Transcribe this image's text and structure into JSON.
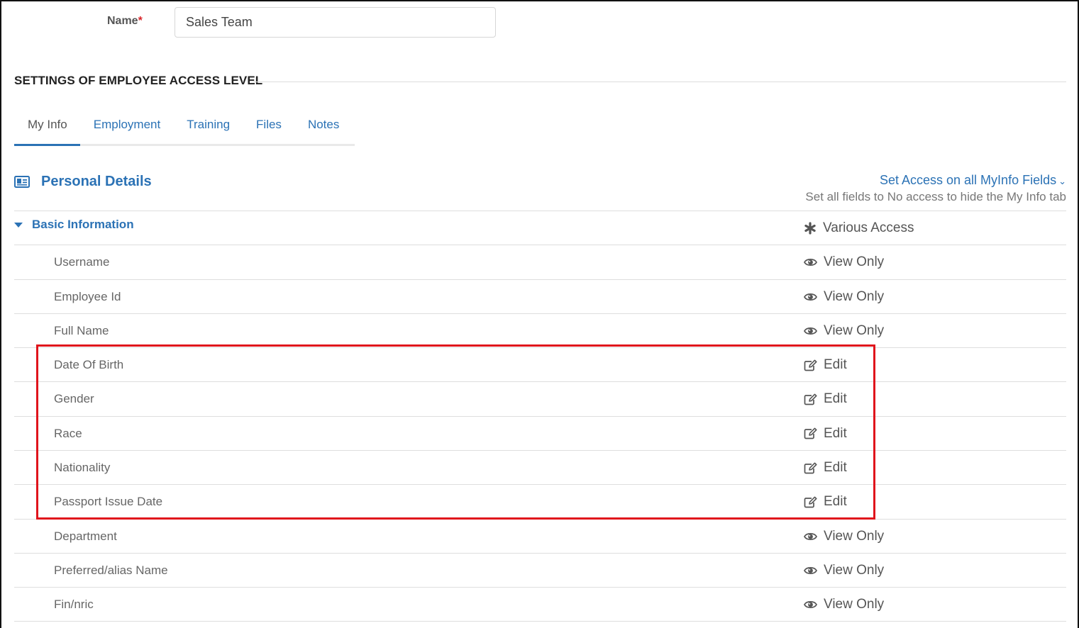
{
  "form": {
    "name_label": "Name",
    "required_mark": "*",
    "name_value": "Sales Team"
  },
  "settings_heading": "SETTINGS OF EMPLOYEE ACCESS LEVEL",
  "tabs": [
    {
      "label": "My Info",
      "active": true
    },
    {
      "label": "Employment",
      "active": false
    },
    {
      "label": "Training",
      "active": false
    },
    {
      "label": "Files",
      "active": false
    },
    {
      "label": "Notes",
      "active": false
    }
  ],
  "personal_details": {
    "icon": "id-card-icon",
    "title": "Personal Details",
    "set_access_link": "Set Access on all MyInfo Fields",
    "set_access_hint": "Set all fields to No access to hide the My Info tab"
  },
  "group": {
    "label": "Basic Information",
    "access": "Various Access",
    "access_icon": "asterisk-icon"
  },
  "fields": [
    {
      "label": "Username",
      "access": "View Only",
      "icon": "eye-icon"
    },
    {
      "label": "Employee Id",
      "access": "View Only",
      "icon": "eye-icon"
    },
    {
      "label": "Full Name",
      "access": "View Only",
      "icon": "eye-icon"
    },
    {
      "label": "Date Of Birth",
      "access": "Edit",
      "icon": "edit-icon"
    },
    {
      "label": "Gender",
      "access": "Edit",
      "icon": "edit-icon"
    },
    {
      "label": "Race",
      "access": "Edit",
      "icon": "edit-icon"
    },
    {
      "label": "Nationality",
      "access": "Edit",
      "icon": "edit-icon"
    },
    {
      "label": "Passport Issue Date",
      "access": "Edit",
      "icon": "edit-icon"
    },
    {
      "label": "Department",
      "access": "View Only",
      "icon": "eye-icon"
    },
    {
      "label": "Preferred/alias Name",
      "access": "View Only",
      "icon": "eye-icon"
    },
    {
      "label": "Fin/nric",
      "access": "View Only",
      "icon": "eye-icon"
    }
  ],
  "colors": {
    "link_blue": "#2b72b5",
    "required_red": "#d9262a",
    "highlight_red": "#e0141c"
  }
}
